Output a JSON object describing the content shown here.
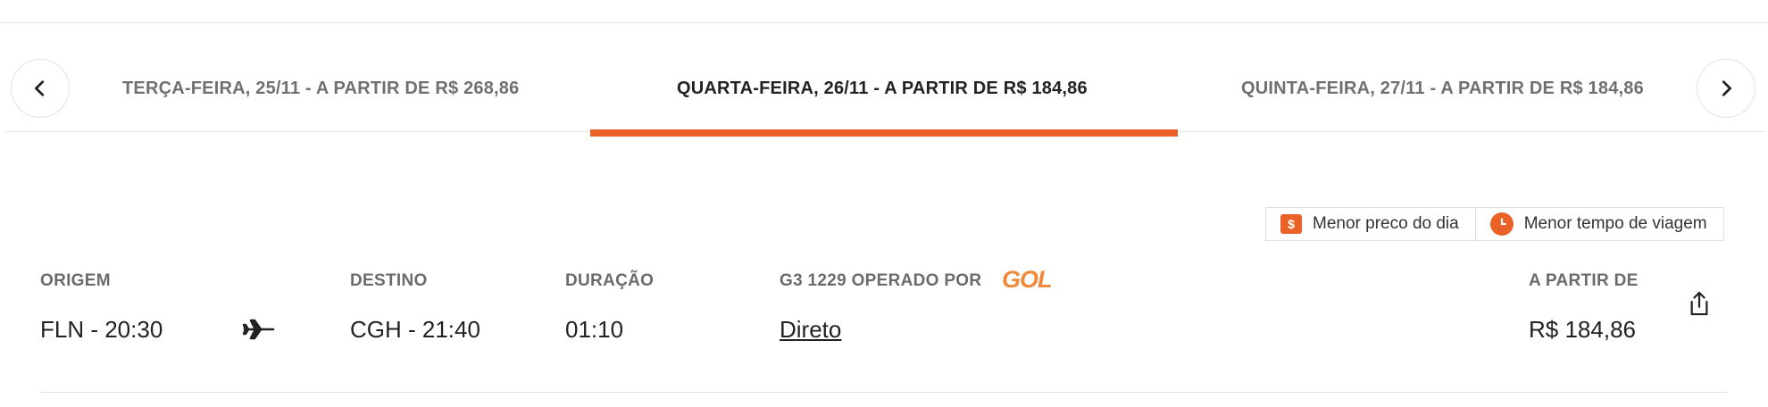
{
  "date_tabs": {
    "prev": "TERÇA-FEIRA, 25/11 - A PARTIR DE R$ 268,86",
    "current": "QUARTA-FEIRA, 26/11 - A PARTIR DE R$ 184,86",
    "next": "QUINTA-FEIRA, 27/11 - A PARTIR DE R$ 184,86",
    "active_color": "#ea6228"
  },
  "legend": {
    "cheapest": "Menor preco do dia",
    "cheapest_symbol": "$",
    "fastest": "Menor tempo de viagem"
  },
  "flight": {
    "origin_label": "ORIGEM",
    "origin_value": "FLN - 20:30",
    "destination_label": "DESTINO",
    "destination_value": "CGH - 21:40",
    "duration_label": "DURAÇÃO",
    "duration_value": "01:10",
    "operator_label": "G3 1229 OPERADO POR",
    "airline_logo_text": "GOL",
    "stops_value": "Direto",
    "price_label": "A PARTIR DE",
    "price_value": "R$ 184,86"
  },
  "icons": {
    "prev": "chevron-left-icon",
    "next": "chevron-right-icon",
    "plane": "airplane-icon",
    "share": "share-icon",
    "clock": "clock-icon"
  }
}
